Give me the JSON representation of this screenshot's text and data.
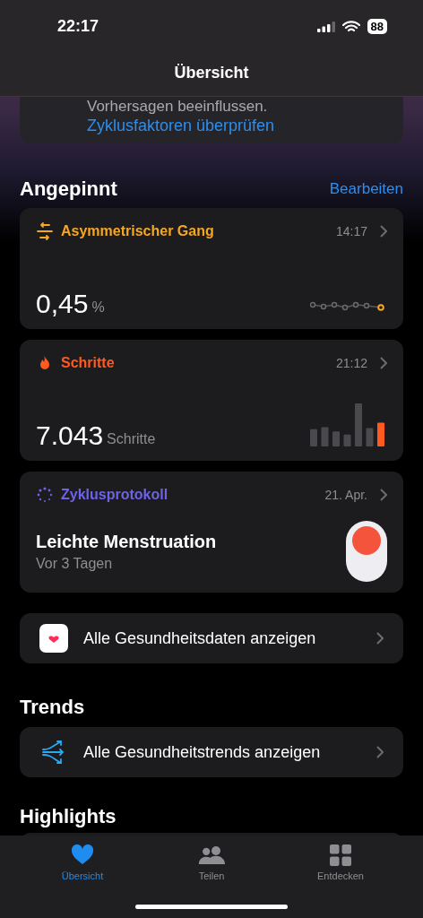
{
  "status_bar": {
    "time": "22:17",
    "battery": "88"
  },
  "nav": {
    "title": "Übersicht"
  },
  "cycle_card": {
    "text": "Vorhersagen beeinflussen.",
    "link": "Zyklusfaktoren überprüfen"
  },
  "pinned": {
    "title": "Angepinnt",
    "action": "Bearbeiten",
    "cards": [
      {
        "kind": "gait",
        "title": "Asymmetrischer Gang",
        "color": "#f5a623",
        "time": "14:17",
        "value": "0,45",
        "unit": "%"
      },
      {
        "kind": "steps",
        "title": "Schritte",
        "color": "#ff5a1f",
        "time": "21:12",
        "value": "7.043",
        "unit": "Schritte"
      },
      {
        "kind": "cycle",
        "title": "Zyklusprotokoll",
        "color": "#6e62e6",
        "time": "21. Apr.",
        "value": "Leichte Menstruation",
        "sub": "Vor 3 Tagen"
      }
    ]
  },
  "all_data": {
    "label": "Alle Gesundheitsdaten anzeigen"
  },
  "trends": {
    "title": "Trends",
    "row": "Alle Gesundheitstrends anzeigen"
  },
  "highlights": {
    "title": "Highlights"
  },
  "tabs": [
    {
      "kind": "summary",
      "label": "Übersicht",
      "selected": true
    },
    {
      "kind": "sharing",
      "label": "Teilen",
      "selected": false
    },
    {
      "kind": "browse",
      "label": "Entdecken",
      "selected": false
    }
  ]
}
